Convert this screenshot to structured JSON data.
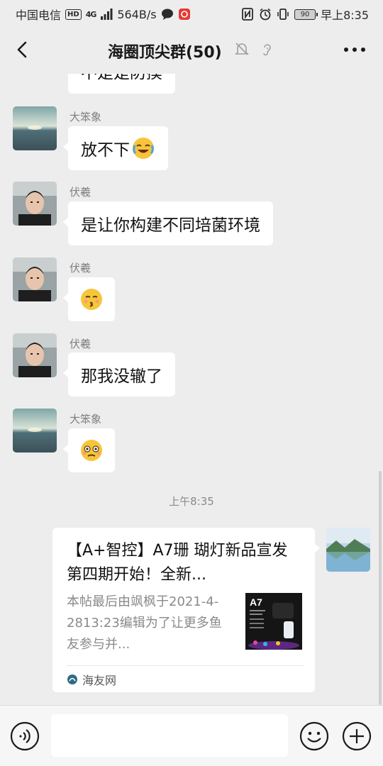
{
  "status_bar": {
    "carrier": "中国电信",
    "hd": "HD",
    "network": "4G",
    "speed": "564B/s",
    "battery": "90",
    "time": "早上8:35"
  },
  "header": {
    "title": "海圈顶尖群(50)",
    "icons": [
      "back-icon",
      "mute-bell-icon",
      "earpiece-icon",
      "more-icon"
    ]
  },
  "messages": [
    {
      "sender": "",
      "text": "不是是防摸",
      "avatar": "sea-sunset"
    },
    {
      "sender": "大笨象",
      "text": "放不下",
      "emoji": "crying-laughing",
      "avatar": "sea-sunset"
    },
    {
      "sender": "伏羲",
      "text": "是让你构建不同培菌环境",
      "avatar": "man-portrait"
    },
    {
      "sender": "伏羲",
      "text": "",
      "emoji": "kissing-face",
      "avatar": "man-portrait"
    },
    {
      "sender": "伏羲",
      "text": "那我没辙了",
      "avatar": "man-portrait"
    },
    {
      "sender": "大笨象",
      "text": "",
      "emoji": "flushed-face",
      "avatar": "sea-sunset"
    }
  ],
  "timestamp": "上午8:35",
  "link_card": {
    "title": "【A+智控】A7珊 瑚灯新品宣发 第四期开始！全新...",
    "description": "本帖最后由飒枫于2021-4-2813:23编辑为了让更多鱼友参与并...",
    "thumb_text": "A7",
    "source": "海友网",
    "avatar": "lake-mountains"
  },
  "input_bar": {
    "icons": [
      "voice-icon",
      "emoji-icon",
      "plus-icon"
    ],
    "placeholder": ""
  },
  "colors": {
    "background": "#ededed",
    "bubble": "#ffffff",
    "sender_text": "#7f7f7f"
  }
}
